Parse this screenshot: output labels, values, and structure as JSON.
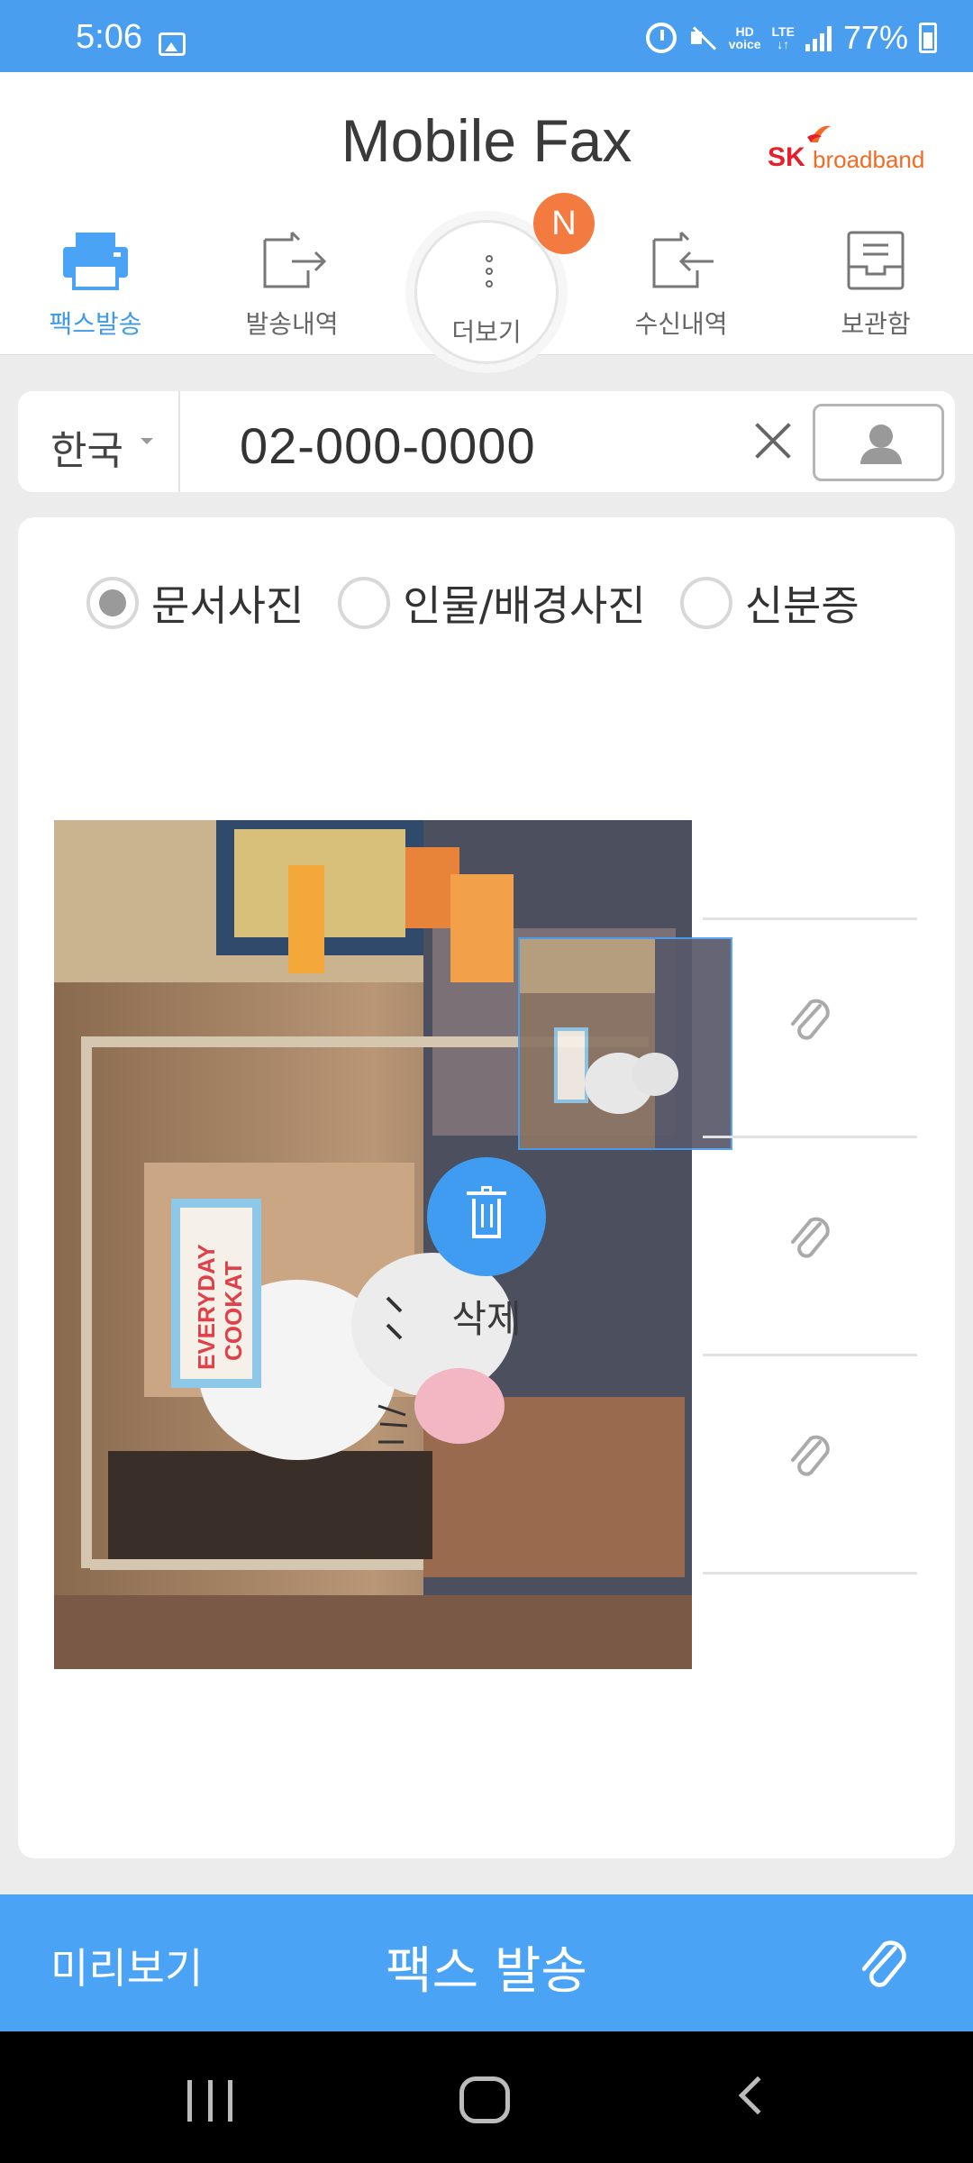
{
  "status_bar": {
    "time": "5:06",
    "battery": "77%",
    "hd": "HD",
    "voice": "voice",
    "lte": "LTE"
  },
  "header": {
    "title": "Mobile Fax",
    "brand_sk": "SK",
    "brand_name": "broadband"
  },
  "tabs": [
    {
      "label": "팩스발송",
      "icon": "printer-icon",
      "active": true
    },
    {
      "label": "발송내역",
      "icon": "send-history-icon",
      "active": false
    },
    {
      "label": "더보기",
      "icon": "more-icon",
      "active": false
    },
    {
      "label": "수신내역",
      "icon": "receive-history-icon",
      "active": false
    },
    {
      "label": "보관함",
      "icon": "archive-icon",
      "active": false
    }
  ],
  "badge": {
    "text": "N"
  },
  "number_row": {
    "country": "한국",
    "fax_number": "02-000-0000"
  },
  "photo_types": [
    {
      "label": "문서사진",
      "checked": true
    },
    {
      "label": "인물/배경사진",
      "checked": false
    },
    {
      "label": "신분증",
      "checked": false
    }
  ],
  "photo": {
    "sign_line1": "EVERYDAY",
    "sign_line2": "COOKAT"
  },
  "delete": {
    "label": "삭제"
  },
  "bottom_bar": {
    "preview": "미리보기",
    "send": "팩스 발송"
  },
  "colors": {
    "primary": "#4a9ef0",
    "badge": "#f47b3f",
    "sk_red": "#e4202b",
    "sk_orange": "#f26a24"
  }
}
